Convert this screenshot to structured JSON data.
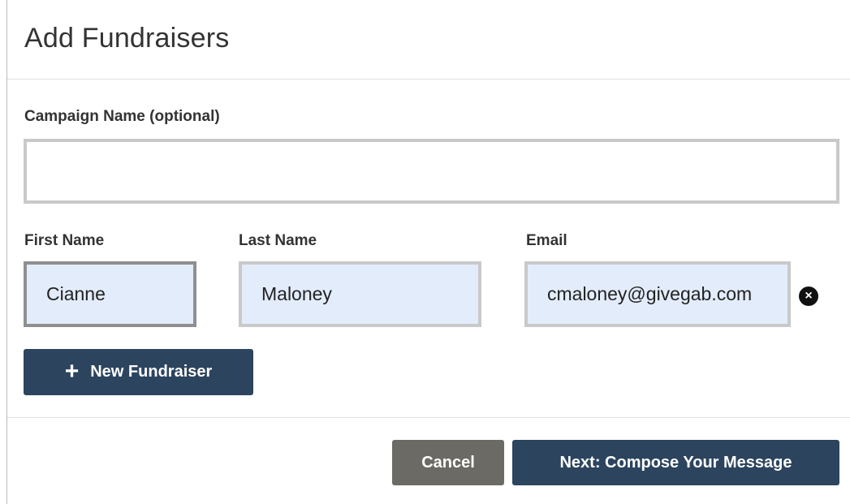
{
  "modal": {
    "title": "Add Fundraisers"
  },
  "campaign": {
    "label": "Campaign Name (optional)",
    "value": ""
  },
  "fundraiser": {
    "first_name_label": "First Name",
    "last_name_label": "Last Name",
    "email_label": "Email",
    "first_name_value": "Cianne",
    "last_name_value": "Maloney",
    "email_value": "cmaloney@givegab.com",
    "remove_icon": "×"
  },
  "actions": {
    "new_fundraiser_icon": "+",
    "new_fundraiser_label": "New Fundraiser",
    "cancel_label": "Cancel",
    "next_label": "Next: Compose Your Message"
  },
  "colors": {
    "primary": "#2c445e",
    "secondary": "#6b6a64",
    "input_filled_bg": "#e3ecfb"
  }
}
